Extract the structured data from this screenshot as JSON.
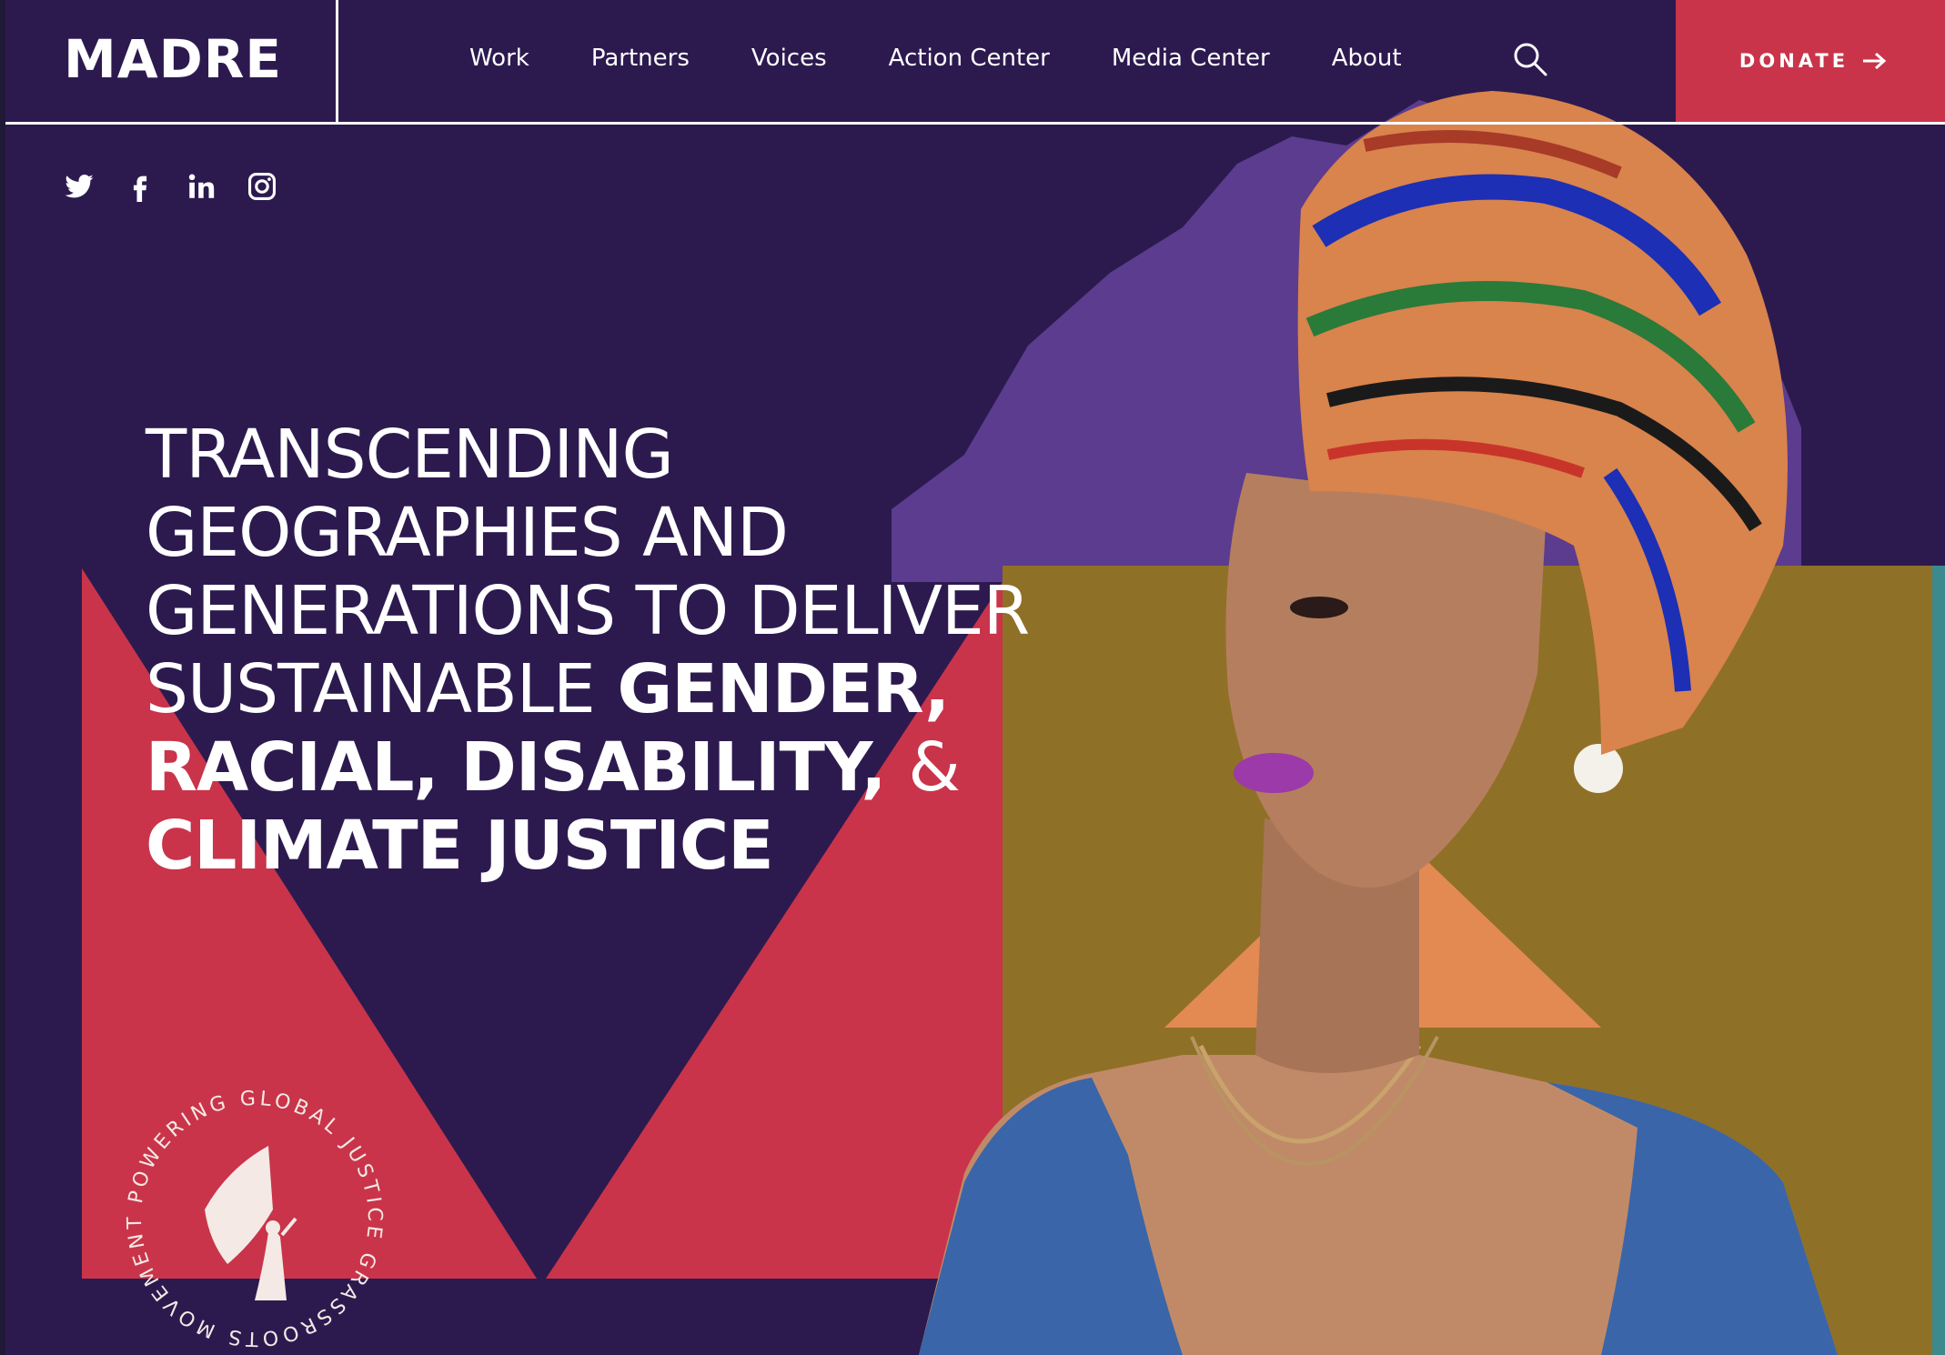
{
  "brand": {
    "logo_text": "MADRE"
  },
  "nav": {
    "items": [
      {
        "label": "Work"
      },
      {
        "label": "Partners"
      },
      {
        "label": "Voices"
      },
      {
        "label": "Action Center"
      },
      {
        "label": "Media Center"
      },
      {
        "label": "About"
      }
    ],
    "search_icon": "search-icon",
    "donate_label": "DONATE",
    "donate_icon": "arrow-right-icon"
  },
  "social": {
    "icons": [
      "twitter-icon",
      "facebook-icon",
      "linkedin-icon",
      "instagram-icon"
    ]
  },
  "hero": {
    "headline_light": "TRANSCENDING GEOGRAPHIES AND GENERATIONS TO DELIVER SUSTAINABLE",
    "headline_bold_1": "GENDER,",
    "headline_bold_2": "RACIAL, DISABILITY,",
    "headline_amp": "&",
    "headline_bold_3": "CLIMATE JUSTICE",
    "seal_text": "POWERING GLOBAL JUSTICE GRASSROOTS MOVEMENTS"
  },
  "colors": {
    "background": "#2c1a4f",
    "accent_red": "#c9344a",
    "mustard": "#8f7027",
    "orange": "#e38a52",
    "mountain_purple": "#5b3c8e",
    "teal": "#3c8a8e",
    "text": "#ffffff"
  }
}
